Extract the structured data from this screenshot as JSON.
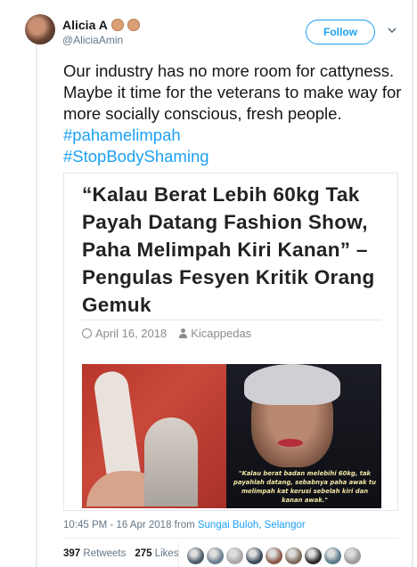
{
  "author": {
    "name": "Alicia A",
    "handle": "@AliciaAmin",
    "emoji_icons": [
      "raised-fist-icon",
      "raised-fist-icon"
    ]
  },
  "follow_label": "Follow",
  "tweet": {
    "text": "Our industry has no more room for cattyness. Maybe it time for the veterans to make way for more socially conscious, fresh people.",
    "hashtags": [
      "#pahamelimpah",
      "#StopBodyShaming"
    ]
  },
  "card": {
    "headline": "“Kalau Berat Lebih 60kg Tak Payah Datang Fashion Show, Paha Melimpah Kiri Kanan” – Pengulas Fesyen Kritik Orang Gemuk",
    "date": "April 16, 2018",
    "author": "Kicappedas",
    "image_caption": "\"Kalau berat badan melebihi 60kg, tak payahlah datang, sebabnya paha awak tu melimpah kat kerusi sebelah kiri dan kanan awak.\""
  },
  "timestamp": {
    "time": "10:45 PM - 16 Apr 2018 from ",
    "location": "Sungai Buloh, Selangor"
  },
  "stats": {
    "retweets_count": "397",
    "retweets_label": "Retweets",
    "likes_count": "275",
    "likes_label": "Likes"
  },
  "colors": {
    "accent": "#1da1f2",
    "muted": "#657786",
    "likers": [
      "#4a5a6a",
      "#6b7d8f",
      "#a8a8a8",
      "#3c4a5a",
      "#8a5a48",
      "#7a6a5a",
      "#2a2a2a",
      "#5a7a8a",
      "#9a9a9a"
    ]
  }
}
